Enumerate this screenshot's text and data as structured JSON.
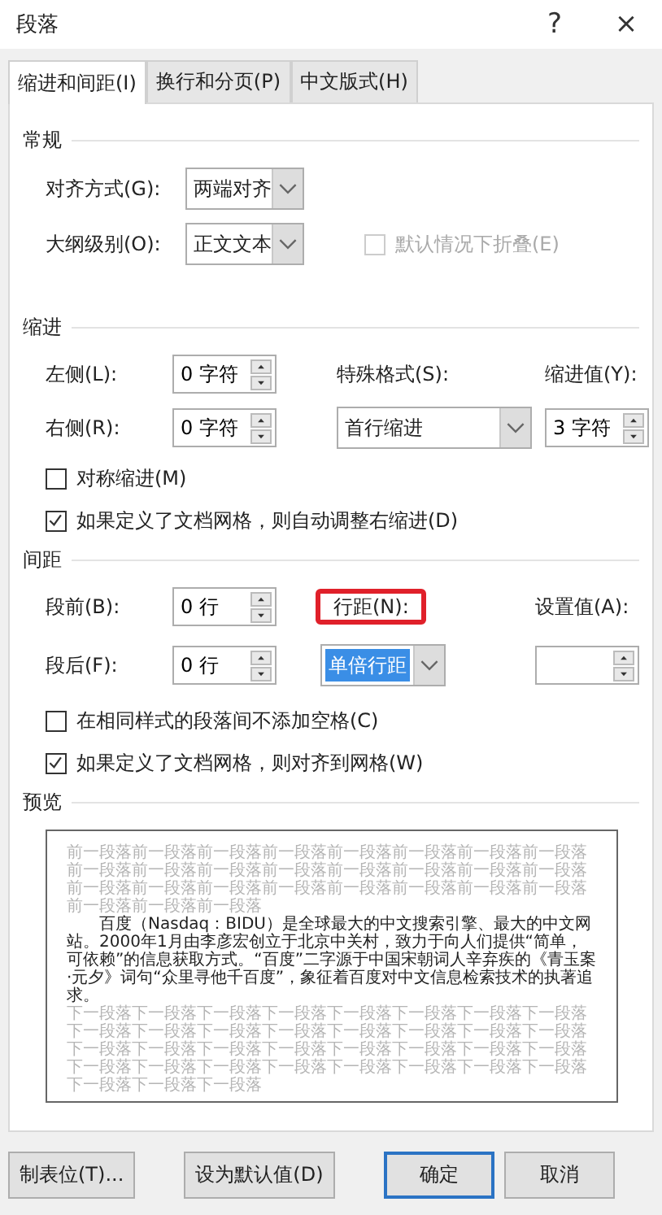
{
  "window": {
    "title": "段落",
    "help": "?",
    "close": "×"
  },
  "tabs": [
    {
      "label": "缩进和间距(I)",
      "selected": true
    },
    {
      "label": "换行和分页(P)",
      "selected": false
    },
    {
      "label": "中文版式(H)",
      "selected": false
    }
  ],
  "general": {
    "heading": "常规",
    "alignment": {
      "label": "对齐方式(G):",
      "value": "两端对齐"
    },
    "outline_level": {
      "label": "大纲级别(O):",
      "value": "正文文本"
    },
    "collapse": {
      "label": "默认情况下折叠(E)",
      "checked": false,
      "disabled": true
    }
  },
  "indent": {
    "heading": "缩进",
    "left": {
      "label": "左侧(L):",
      "value": "0 字符"
    },
    "right": {
      "label": "右侧(R):",
      "value": "0 字符"
    },
    "special": {
      "label": "特殊格式(S):",
      "value": "首行缩进"
    },
    "by": {
      "label": "缩进值(Y):",
      "value": "3 字符"
    },
    "mirror": {
      "label": "对称缩进(M)",
      "checked": false
    },
    "auto_adjust": {
      "label": "如果定义了文档网格，则自动调整右缩进(D)",
      "checked": true
    }
  },
  "spacing": {
    "heading": "间距",
    "before": {
      "label": "段前(B):",
      "value": "0 行"
    },
    "after": {
      "label": "段后(F):",
      "value": "0 行"
    },
    "line_spacing": {
      "label": "行距(N):",
      "value": "单倍行距",
      "selected": true,
      "highlighted": true
    },
    "at": {
      "label": "设置值(A):"
    },
    "no_space": {
      "label": "在相同样式的段落间不添加空格(C)",
      "checked": false
    },
    "snap": {
      "label": "如果定义了文档网格，则对齐到网格(W)",
      "checked": true
    }
  },
  "preview": {
    "heading": "预览",
    "previous": "前一段落前一段落前一段落前一段落前一段落前一段落前一段落前一段落前一段落前一段落前一段落前一段落前一段落前一段落前一段落前一段落前一段落前一段落前一段落前一段落前一段落前一段落前一段落前一段落前一段落前一段落前一段落",
    "text": "百度（Nasdaq：BIDU）是全球最大的中文搜索引擎、最大的中文网站。2000年1月由李彦宏创立于北京中关村，致力于向人们提供“简单，可依赖”的信息获取方式。“百度”二字源于中国宋朝词人辛弃疾的《青玉案·元夕》词句“众里寻他千百度”，象征着百度对中文信息检索技术的执著追求。",
    "next": "下一段落下一段落下一段落下一段落下一段落下一段落下一段落下一段落下一段落下一段落下一段落下一段落下一段落下一段落下一段落下一段落下一段落下一段落下一段落下一段落下一段落下一段落下一段落下一段落下一段落下一段落下一段落下一段落下一段落下一段落下一段落下一段落下一段落下一段落下一段落"
  },
  "buttons": [
    {
      "label": "制表位(T)...",
      "default": false
    },
    {
      "label": "设为默认值(D)",
      "default": false
    },
    {
      "label": "确定",
      "default": true
    },
    {
      "label": "取消",
      "default": false
    }
  ]
}
